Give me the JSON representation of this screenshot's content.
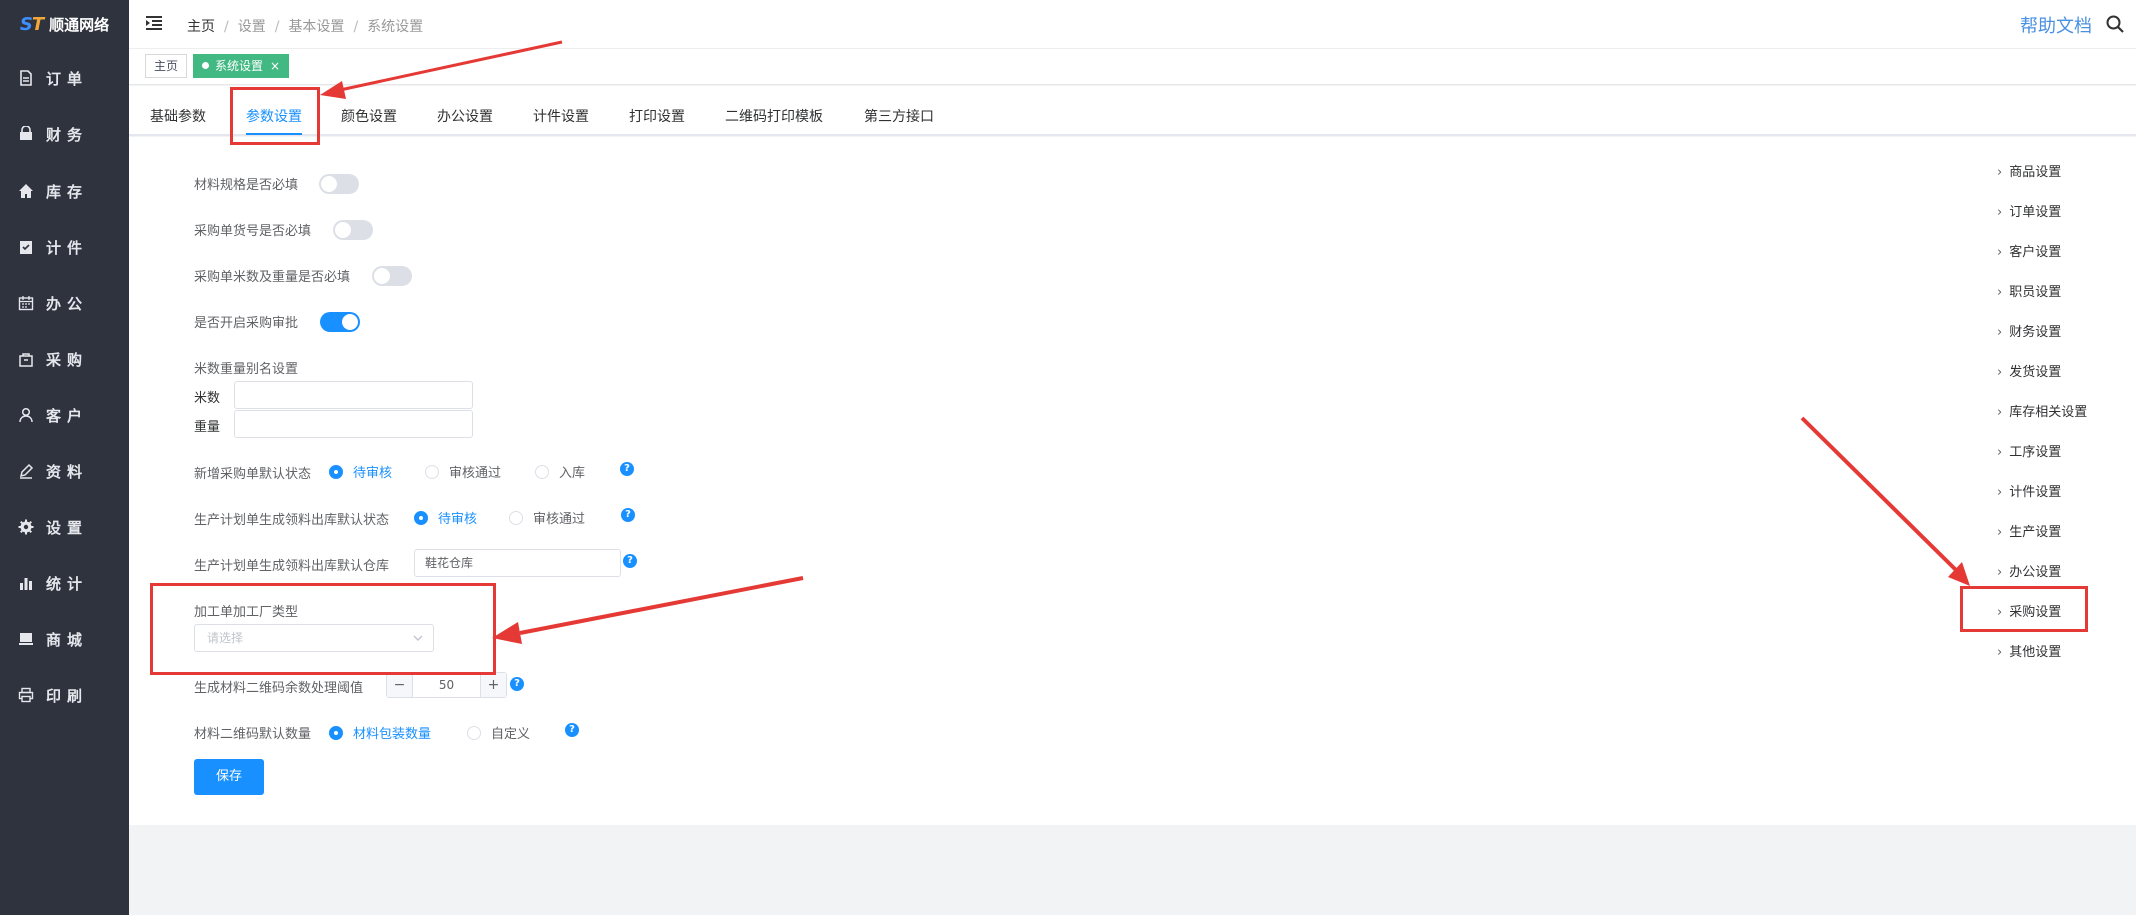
{
  "brand": {
    "name": "顺通网络",
    "mark_a": "S",
    "mark_b": "T"
  },
  "sidebar": {
    "items": [
      {
        "label": "订单",
        "icon": "order-icon"
      },
      {
        "label": "财务",
        "icon": "finance-icon"
      },
      {
        "label": "库存",
        "icon": "home-icon"
      },
      {
        "label": "计件",
        "icon": "clipboard-icon"
      },
      {
        "label": "办公",
        "icon": "calendar-icon"
      },
      {
        "label": "采购",
        "icon": "bag-icon"
      },
      {
        "label": "客户",
        "icon": "user-icon"
      },
      {
        "label": "资料",
        "icon": "edit-icon"
      },
      {
        "label": "设置",
        "icon": "gear-icon"
      },
      {
        "label": "统计",
        "icon": "bar-chart-icon"
      },
      {
        "label": "商城",
        "icon": "shop-icon"
      },
      {
        "label": "印刷",
        "icon": "printer-icon"
      }
    ]
  },
  "header": {
    "breadcrumb": [
      "主页",
      "设置",
      "基本设置",
      "系统设置"
    ],
    "separator": "/",
    "help_label": "帮助文档"
  },
  "page_tags": {
    "home": "主页",
    "active": "系统设置",
    "close": "×"
  },
  "tabs": [
    "基础参数",
    "参数设置",
    "颜色设置",
    "办公设置",
    "计件设置",
    "打印设置",
    "二维码打印模板",
    "第三方接口"
  ],
  "active_tab": "参数设置",
  "form": {
    "switch_rows": [
      {
        "label": "材料规格是否必填",
        "on": false
      },
      {
        "label": "采购单货号是否必填",
        "on": false
      },
      {
        "label": "采购单米数及重量是否必填",
        "on": false
      },
      {
        "label": "是否开启采购审批",
        "on": true
      }
    ],
    "alias": {
      "title": "米数重量别名设置",
      "meter_label": "米数",
      "meter_value": "",
      "weight_label": "重量",
      "weight_value": ""
    },
    "purchase_default_status": {
      "label": "新增采购单默认状态",
      "options": [
        "待审核",
        "审核通过",
        "入库"
      ],
      "selected": "待审核"
    },
    "plan_outbound_status": {
      "label": "生产计划单生成领料出库默认状态",
      "options": [
        "待审核",
        "审核通过"
      ],
      "selected": "待审核"
    },
    "plan_warehouse": {
      "label": "生产计划单生成领料出库默认仓库",
      "value": "鞋花仓库"
    },
    "factory_type": {
      "label": "加工单加工厂类型",
      "placeholder": "请选择"
    },
    "qr_threshold": {
      "label": "生成材料二维码余数处理阈值",
      "value": "50",
      "minus": "−",
      "plus": "+"
    },
    "qr_default_qty": {
      "label": "材料二维码默认数量",
      "options": [
        "材料包装数量",
        "自定义"
      ],
      "selected": "材料包装数量"
    },
    "help_mark": "?",
    "save_label": "保存"
  },
  "settings_menu": {
    "items": [
      "商品设置",
      "订单设置",
      "客户设置",
      "职员设置",
      "财务设置",
      "发货设置",
      "库存相关设置",
      "工序设置",
      "计件设置",
      "生产设置",
      "办公设置",
      "采购设置",
      "其他设置"
    ],
    "highlighted": "采购设置"
  },
  "colors": {
    "sidebar_bg": "#2e333e",
    "accent": "#1890ff",
    "tag_active": "#42b983",
    "annotation_red": "#e53935"
  }
}
